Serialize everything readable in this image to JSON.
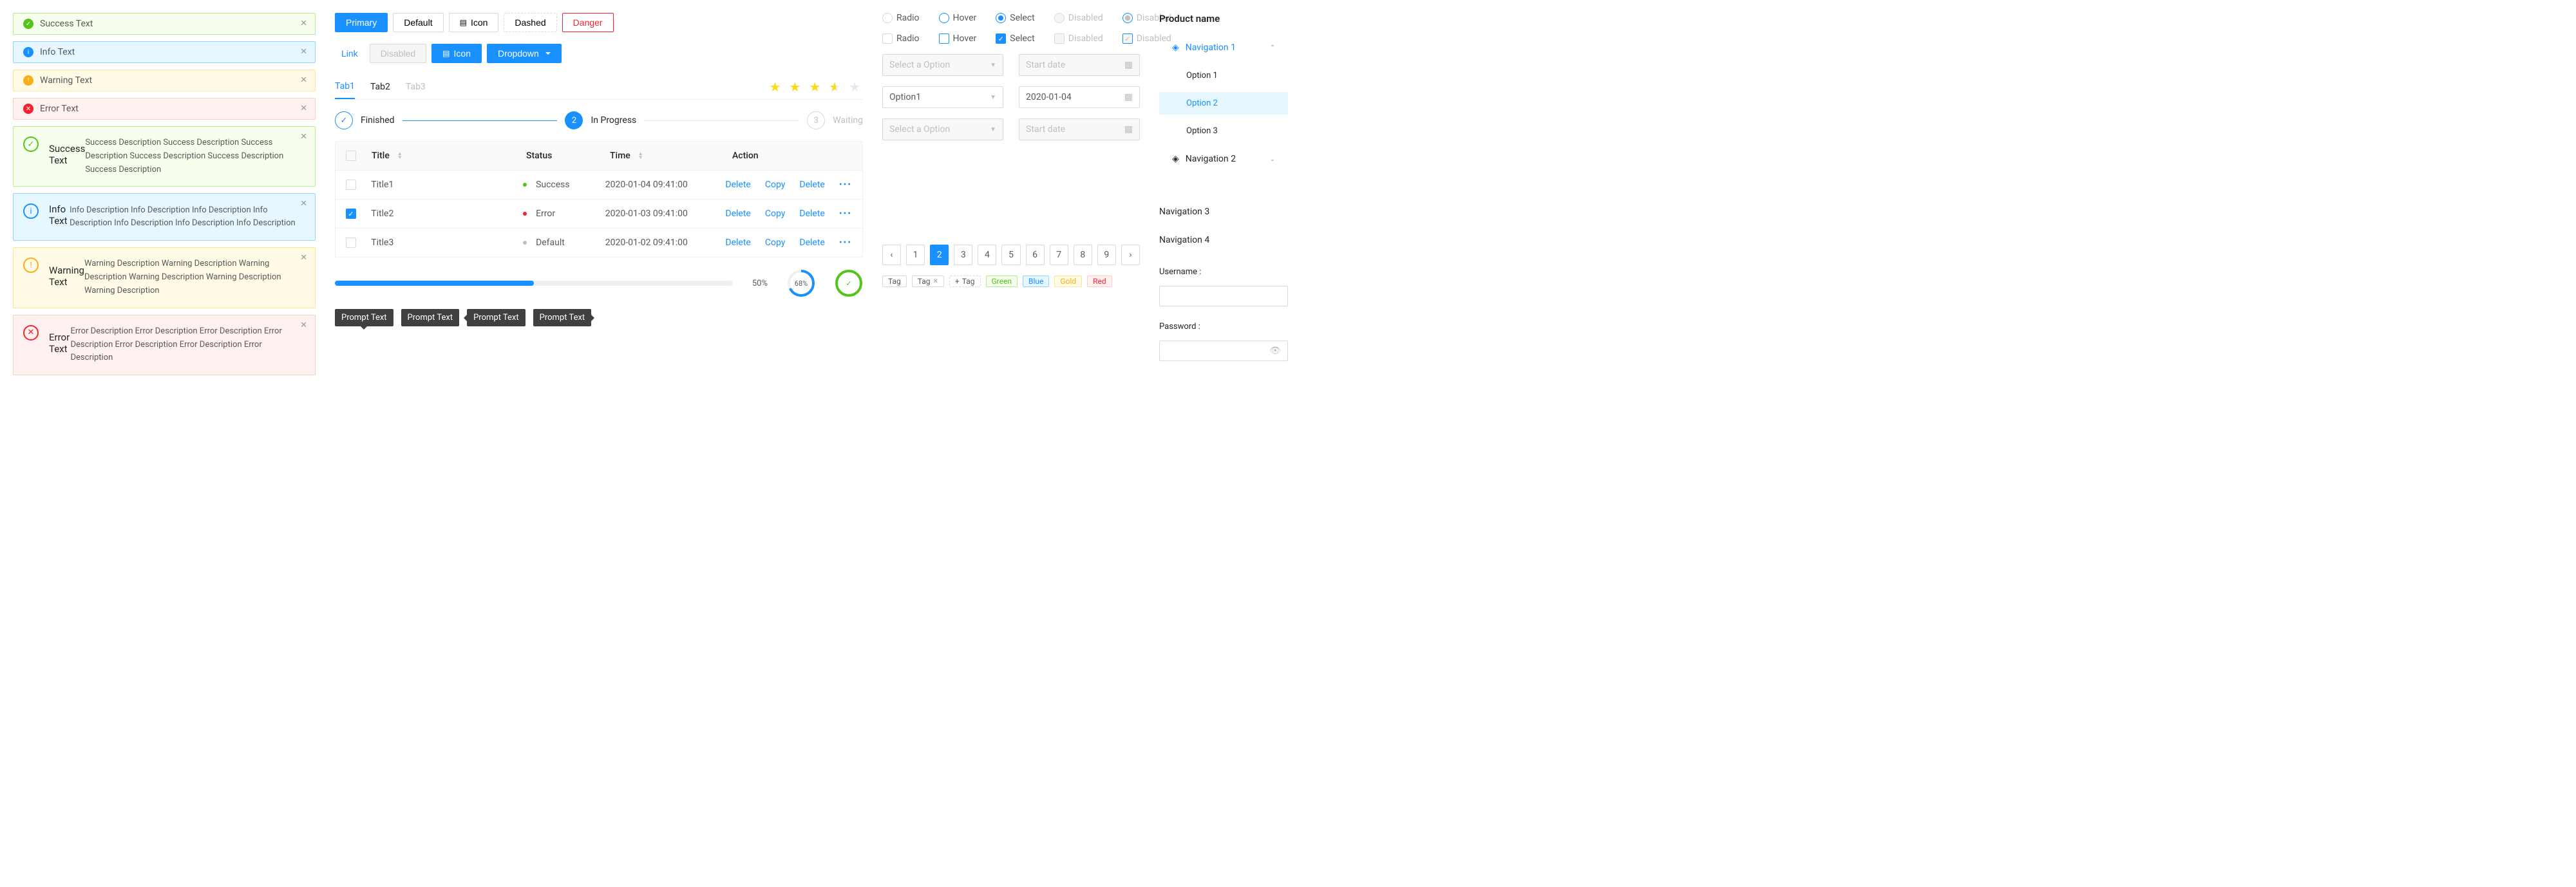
{
  "alerts": {
    "success": "Success Text",
    "info": "Info Text",
    "warning": "Warning Text",
    "error": "Error Text",
    "successDesc": "Success Description Success Description Success Description Success Description Success Description Success Description",
    "infoDesc": "Info Description Info Description Info Description Info Description Info Description Info Description Info Description",
    "warningDesc": "Warning Description Warning Description Warning Description Warning Description Warning Description Warning Description",
    "errorDesc": "Error Description Error Description Error Description Error Description Error Description Error Description Error Description"
  },
  "buttons": {
    "primary": "Primary",
    "default": "Default",
    "icon": "Icon",
    "dashed": "Dashed",
    "danger": "Danger",
    "link": "Link",
    "disabled": "Disabled",
    "dropdown": "Dropdown"
  },
  "tabs": {
    "t1": "Tab1",
    "t2": "Tab2",
    "t3": "Tab3"
  },
  "steps": {
    "s1": "Finished",
    "s2": "In Progress",
    "s3": "Waiting",
    "n2": "2",
    "n3": "3"
  },
  "table": {
    "hTitle": "Title",
    "hStatus": "Status",
    "hTime": "Time",
    "hAction": "Action",
    "rows": [
      {
        "title": "Title1",
        "status": "Success",
        "time": "2020-01-04  09:41:00"
      },
      {
        "title": "Title2",
        "status": "Error",
        "time": "2020-01-03  09:41:00"
      },
      {
        "title": "Title3",
        "status": "Default",
        "time": "2020-01-02  09:41:00"
      }
    ],
    "delete": "Delete",
    "copy": "Copy"
  },
  "progress": {
    "pct": "50%",
    "circle": "68%"
  },
  "tooltip": "Prompt Text",
  "rc": {
    "radio": "Radio",
    "hover": "Hover",
    "select": "Select",
    "disabled": "Disabled"
  },
  "select": {
    "ph": "Select a Option",
    "val": "Option1"
  },
  "date": {
    "ph": "Start date",
    "val": "2020-01-04"
  },
  "pag": {
    "p1": "1",
    "p2": "2",
    "p3": "3",
    "p4": "4",
    "p5": "5",
    "p6": "6",
    "p7": "7",
    "p8": "8",
    "p9": "9"
  },
  "tags": {
    "tag": "Tag",
    "green": "Green",
    "blue": "Blue",
    "gold": "Gold",
    "red": "Red"
  },
  "nav": {
    "product": "Product name",
    "n1": "Navigation 1",
    "n2": "Navigation 2",
    "n3": "Navigation 3",
    "n4": "Navigation 4",
    "o1": "Option 1",
    "o2": "Option 2",
    "o3": "Option 3"
  },
  "form": {
    "username": "Username :",
    "password": "Password :"
  }
}
